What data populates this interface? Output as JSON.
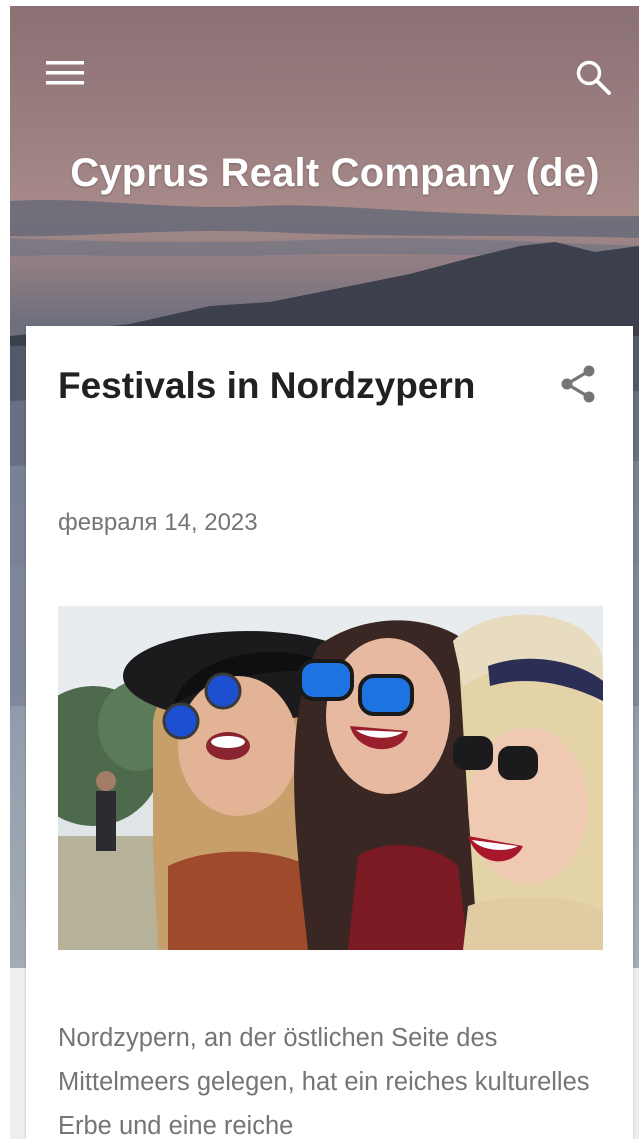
{
  "header": {
    "blog_title": "Cyprus Realt Company (de)",
    "menu_icon": "hamburger-menu-icon",
    "search_icon": "search-icon"
  },
  "post": {
    "title": "Festivals in Nordzypern",
    "date": "февраля 14, 2023",
    "share_icon": "share-icon",
    "image_description": "three women laughing at a festival",
    "snippet": "Nordzypern, an der östlichen Seite des Mittelmeers gelegen, hat ein reiches kulturelles Erbe und eine reiche"
  },
  "colors": {
    "header_text": "#ffffff",
    "title_text": "#212121",
    "meta_text": "#757575",
    "card_background": "#ffffff",
    "page_background": "#eeeeee"
  }
}
